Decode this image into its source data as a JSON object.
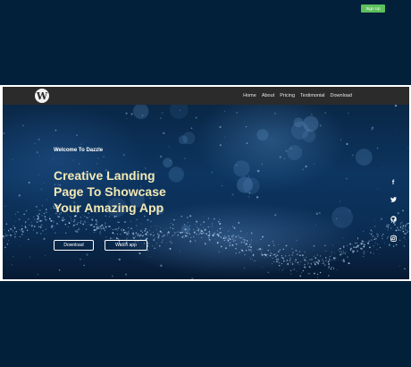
{
  "nav": {
    "logo_glyph": "W",
    "links": [
      "Home",
      "About",
      "Pricing",
      "Testimonial",
      "Download"
    ],
    "signup_label": "Sign Up",
    "signup_color": "#5cc05c"
  },
  "hero": {
    "welcome": "Welcome To Dazzle",
    "headline_lines": [
      "Creative Landing",
      "Page To Showcase",
      "Your Amazing App"
    ],
    "headline_color": "#f3e9b4",
    "download_label": "Download",
    "watch_label": "Watch app"
  },
  "social_icons": [
    "facebook-icon",
    "twitter-icon",
    "github-icon",
    "instagram-icon"
  ],
  "colors": {
    "page_background": "#03203a",
    "navbar": "#2b2b2b"
  }
}
